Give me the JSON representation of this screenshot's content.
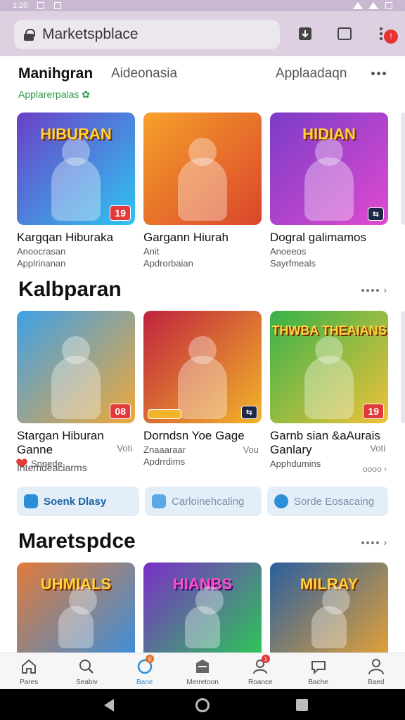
{
  "status": {
    "time": "1:20"
  },
  "browser": {
    "url": "Marketspblace",
    "menu_badge": "!"
  },
  "top_tabs": {
    "active": "Manihgran",
    "tab2": "Aideonasia",
    "tab3": "Applaadaqn"
  },
  "subtitle": "Applarerpalas",
  "sections": [
    {
      "title": "",
      "cards": [
        {
          "art": "HIBURAN",
          "badge": "19",
          "title": "Kargqan Hiburaka",
          "line1": "Anoocrasan",
          "line2": "Applrinanan",
          "colors": [
            "#6a3fc7",
            "#2ec4f0"
          ]
        },
        {
          "art": "",
          "badge": "",
          "title": "Gargann Hiurah",
          "line1": "Anit",
          "line2": "Apdrorbaian",
          "colors": [
            "#f7a12b",
            "#d9452b"
          ]
        },
        {
          "art": "HIDIAN",
          "badge": "",
          "title": "Dogral galimamos",
          "line1": "Anoeeos",
          "line2": "Sayrfmeals",
          "colors": [
            "#7a3cc7",
            "#e04ad0"
          ]
        }
      ]
    },
    {
      "title": "Kalbparan",
      "more": "",
      "cards": [
        {
          "art": "",
          "badge": "08",
          "title": "Stargan Hiburan",
          "title2": "Ganne",
          "votes": "Voti",
          "line1": "Snnede",
          "colors": [
            "#3ea0e8",
            "#f0a83a"
          ]
        },
        {
          "art": "",
          "badge": "",
          "title": "Dorndsn Yoe Gage",
          "votes": "Vou",
          "line1": "Znaaaraar",
          "line2": "Apdrrdims",
          "colors": [
            "#c0233c",
            "#f2b52a"
          ]
        },
        {
          "art": "THWBA THEAIANS",
          "badge": "19",
          "title": "Garnb sian &aAurais",
          "title2": "Ganlary",
          "votes": "Voti",
          "line1": "Apphdumins",
          "colors": [
            "#36b24a",
            "#f0c23a"
          ]
        }
      ]
    },
    {
      "title": "Maretspdce",
      "more": "",
      "cards": [
        {
          "art": "UHMIALS",
          "colors": [
            "#e07a3a",
            "#3f8fd8"
          ]
        },
        {
          "art": "HIANBS",
          "colors": [
            "#7a2ec7",
            "#2ec45a"
          ]
        },
        {
          "art": "MILRAY",
          "colors": [
            "#2a5f9e",
            "#e0a03a"
          ]
        }
      ]
    }
  ],
  "intermediate_label": "Intemdeaciarms",
  "intermediate_more": "oooo",
  "pills": [
    {
      "label": "Soenk  Dlasy"
    },
    {
      "label": "Carloinehcaling"
    },
    {
      "label": "Sorde Eosacaing"
    }
  ],
  "bottom_nav": [
    {
      "label": "Pares",
      "icon": "home-icon"
    },
    {
      "label": "Seabiv",
      "icon": "search-icon"
    },
    {
      "label": "Bane",
      "icon": "gamepad-icon",
      "active": true,
      "badge": "0"
    },
    {
      "label": "Merretoon",
      "icon": "store-icon"
    },
    {
      "label": "Roance",
      "icon": "profile-icon",
      "badge": "1"
    },
    {
      "label": "Bache",
      "icon": "chat-icon"
    },
    {
      "label": "Baed",
      "icon": "account-icon"
    }
  ]
}
